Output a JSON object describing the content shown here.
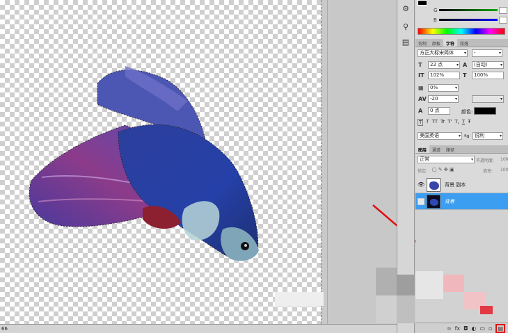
{
  "color_panel": {
    "labels": [
      "G",
      "B"
    ],
    "spectrum": "rainbow"
  },
  "tabs_top": [
    "仿制",
    "颜板",
    "字符",
    "段落"
  ],
  "character": {
    "font_family": "方正大标宋简体",
    "font_style": "-",
    "size": "22 点",
    "leading": "(自动)",
    "vscale": "102%",
    "hscale": "100%",
    "tracking_pct": "0%",
    "kerning": "-20",
    "baseline": "0 点",
    "color_label": "颜色:",
    "styles": [
      "T",
      "T",
      "TT",
      "Tr",
      "T'",
      "T,",
      "T",
      "Ŧ"
    ],
    "language": "美国英语",
    "aa_label": "ªa",
    "aa_value": "锐利"
  },
  "layers_tabs": [
    "图层",
    "通道",
    "路径"
  ],
  "layers_panel": {
    "blend_mode": "正常",
    "opacity_label": "不透明度:",
    "opacity_value": "100",
    "lock_label": "锁定:",
    "fill_label": "填充:",
    "fill_value": "100",
    "layers": [
      {
        "name": "背景 副本",
        "visible": true,
        "selected": false
      },
      {
        "name": "背景",
        "visible": false,
        "selected": true
      }
    ]
  },
  "status": {
    "zoom": "66"
  },
  "colors": {
    "selection": "#3b9ef1",
    "annotation": "#e01010"
  }
}
